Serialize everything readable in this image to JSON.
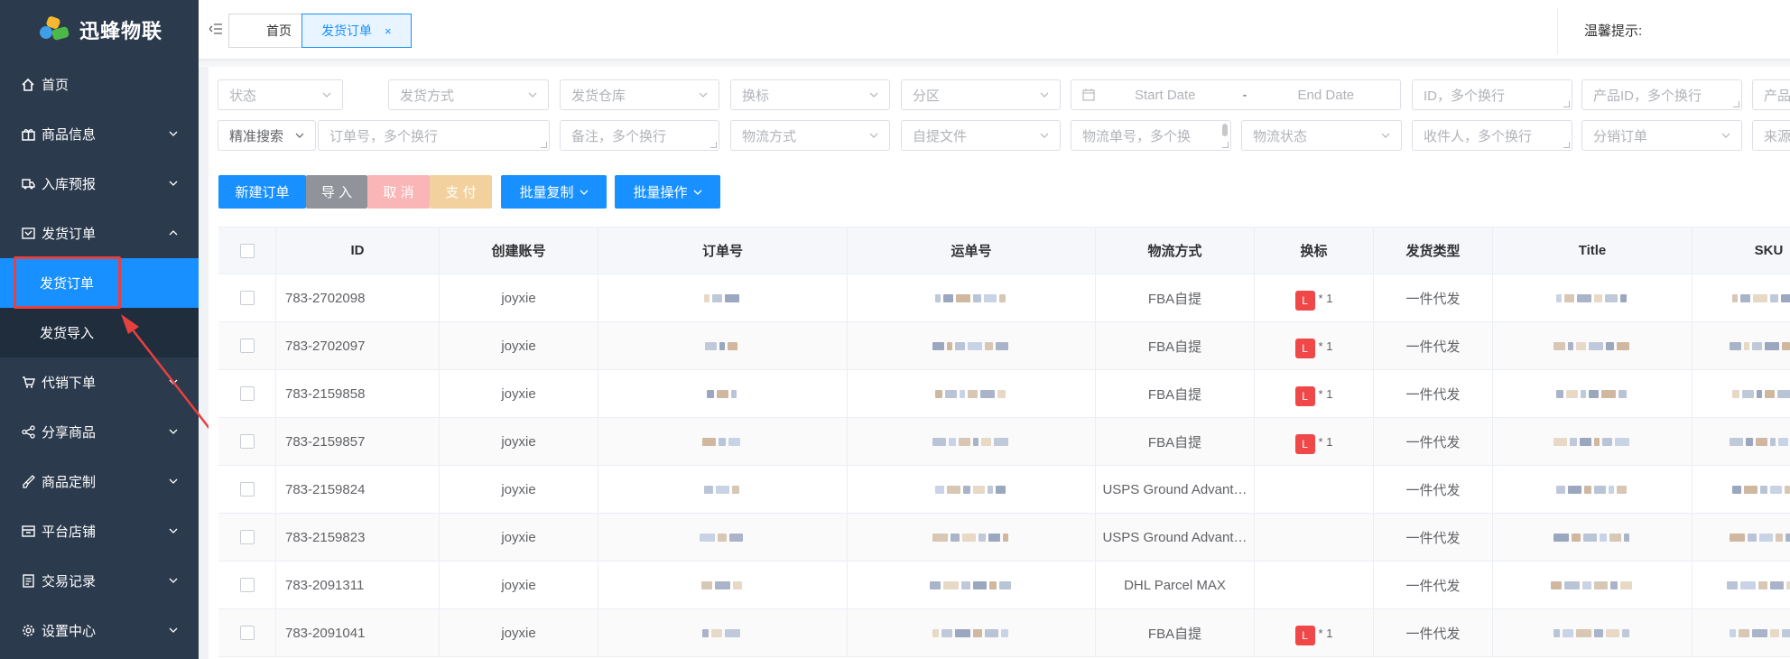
{
  "brand": {
    "name": "迅蜂物联"
  },
  "sidebar": {
    "items": [
      {
        "label": "首页",
        "icon": "home-icon",
        "expandable": false
      },
      {
        "label": "商品信息",
        "icon": "gift-icon",
        "expandable": true
      },
      {
        "label": "入库预报",
        "icon": "truck-icon",
        "expandable": true
      },
      {
        "label": "发货订单",
        "icon": "box-icon",
        "expandable": true,
        "expanded": true
      },
      {
        "label": "代销下单",
        "icon": "cart-icon",
        "expandable": true
      },
      {
        "label": "分享商品",
        "icon": "share-icon",
        "expandable": true
      },
      {
        "label": "商品定制",
        "icon": "brush-icon",
        "expandable": true
      },
      {
        "label": "平台店铺",
        "icon": "store-icon",
        "expandable": true
      },
      {
        "label": "交易记录",
        "icon": "doc-icon",
        "expandable": true
      },
      {
        "label": "设置中心",
        "icon": "gear-icon",
        "expandable": true
      }
    ],
    "sub_items": [
      {
        "label": "发货订单",
        "active": true
      },
      {
        "label": "发货导入",
        "active": false
      }
    ]
  },
  "tabs": [
    {
      "label": "首页"
    },
    {
      "label": "发货订单",
      "closable": true,
      "close": "×"
    }
  ],
  "notice": {
    "label": "温馨提示:"
  },
  "filters": {
    "status": "状态",
    "ship_method": "发货方式",
    "ship_warehouse": "发货仓库",
    "label_change": "换标",
    "zone": "分区",
    "start_date": "Start Date",
    "date_sep": "-",
    "end_date": "End Date",
    "id_ph": "ID，多个换行",
    "product_id_ph": "产品ID，多个换行",
    "product_more": "产品",
    "precise_search": "精准搜索",
    "order_no_ph": "订单号，多个换行",
    "remark_ph": "备注，多个换行",
    "logistics_method": "物流方式",
    "self_pick_file": "自提文件",
    "tracking_ph": "物流单号，多个换",
    "logistics_status": "物流状态",
    "recipient_ph": "收件人，多个换行",
    "dist_order": "分销订单",
    "source": "来源"
  },
  "actions": {
    "new_order": "新建订单",
    "import": "导 入",
    "cancel": "取 消",
    "pay": "支 付",
    "batch_copy": "批量复制",
    "batch_ops": "批量操作"
  },
  "colors": {
    "primary": "#1890ff",
    "sidebar": "#2b3a4d",
    "danger": "#f04848",
    "import_btn": "#909399",
    "cancel_btn": "#fab6b6",
    "pay_btn": "#f3d19e"
  },
  "table": {
    "columns": [
      "ID",
      "创建账号",
      "订单号",
      "运单号",
      "物流方式",
      "换标",
      "发货类型",
      "Title",
      "SKU"
    ],
    "rows": [
      {
        "id": "783-2702098",
        "account": "joyxie",
        "logistics": "FBA自提",
        "label": "L",
        "qty": "* 1",
        "type": "一件代发"
      },
      {
        "id": "783-2702097",
        "account": "joyxie",
        "logistics": "FBA自提",
        "label": "L",
        "qty": "* 1",
        "type": "一件代发"
      },
      {
        "id": "783-2159858",
        "account": "joyxie",
        "logistics": "FBA自提",
        "label": "L",
        "qty": "* 1",
        "type": "一件代发"
      },
      {
        "id": "783-2159857",
        "account": "joyxie",
        "logistics": "FBA自提",
        "label": "L",
        "qty": "* 1",
        "type": "一件代发"
      },
      {
        "id": "783-2159824",
        "account": "joyxie",
        "logistics": "USPS Ground Advant…",
        "label": "",
        "qty": "",
        "type": "一件代发"
      },
      {
        "id": "783-2159823",
        "account": "joyxie",
        "logistics": "USPS Ground Advant…",
        "label": "",
        "qty": "",
        "type": "一件代发"
      },
      {
        "id": "783-2091311",
        "account": "joyxie",
        "logistics": "DHL Parcel MAX",
        "label": "",
        "qty": "",
        "type": "一件代发"
      },
      {
        "id": "783-2091041",
        "account": "joyxie",
        "logistics": "FBA自提",
        "label": "L",
        "qty": "* 1",
        "type": "一件代发"
      }
    ]
  }
}
